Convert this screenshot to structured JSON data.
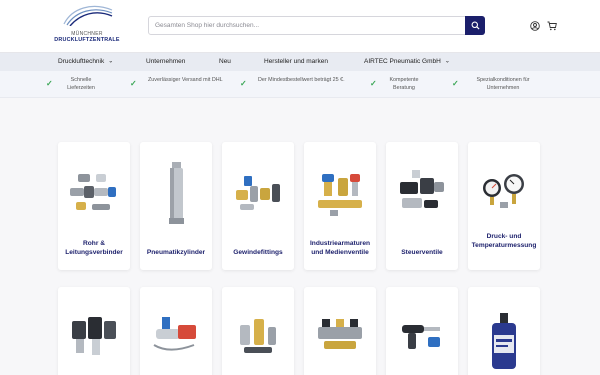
{
  "header": {
    "logo": {
      "line1": "MÜNCHNER",
      "line2": "DRUCKLUFTZENTRALE"
    },
    "search": {
      "placeholder": "Gesamten Shop hier durchsuchen..."
    }
  },
  "nav": {
    "items": [
      {
        "label": "Drucklufttechnik",
        "dropdown": true
      },
      {
        "label": "Unternehmen",
        "dropdown": false
      },
      {
        "label": "Neu",
        "dropdown": false
      },
      {
        "label": "Hersteller und marken",
        "dropdown": false
      },
      {
        "label": "AIRTEC Pneumatic GmbH",
        "dropdown": true
      }
    ]
  },
  "usp": [
    {
      "text": "Schnelle Lieferzeiten"
    },
    {
      "text": "Zuverlässiger Versand mit DHL"
    },
    {
      "text": "Der Mindestbestellwert beträgt 25 €."
    },
    {
      "text": "Kompetente Beratung"
    },
    {
      "text": "Spezialkonditionen für Unternehmen"
    }
  ],
  "categories_row1": [
    {
      "label": "Rohr & Leitungsverbinder",
      "icon": "fittings-icon"
    },
    {
      "label": "Pneumatikzylinder",
      "icon": "cylinder-icon"
    },
    {
      "label": "Gewindefittings",
      "icon": "thread-fittings-icon"
    },
    {
      "label": "Industriearmaturen und Medienventile",
      "icon": "valves-icon"
    },
    {
      "label": "Steuerventile",
      "icon": "control-valve-icon"
    },
    {
      "label": "Druck- und Temperaturmessung",
      "icon": "gauge-icon"
    }
  ],
  "categories_row2": [
    {
      "icon": "filter-regulator-icon"
    },
    {
      "icon": "tool-icon"
    },
    {
      "icon": "muffler-icon"
    },
    {
      "icon": "valve-block-icon"
    },
    {
      "icon": "blow-gun-icon"
    },
    {
      "icon": "sealant-bottle-icon"
    }
  ],
  "colors": {
    "brand": "#1b1f6b",
    "nav_bg": "#e8ebf2",
    "check": "#3aa655"
  }
}
